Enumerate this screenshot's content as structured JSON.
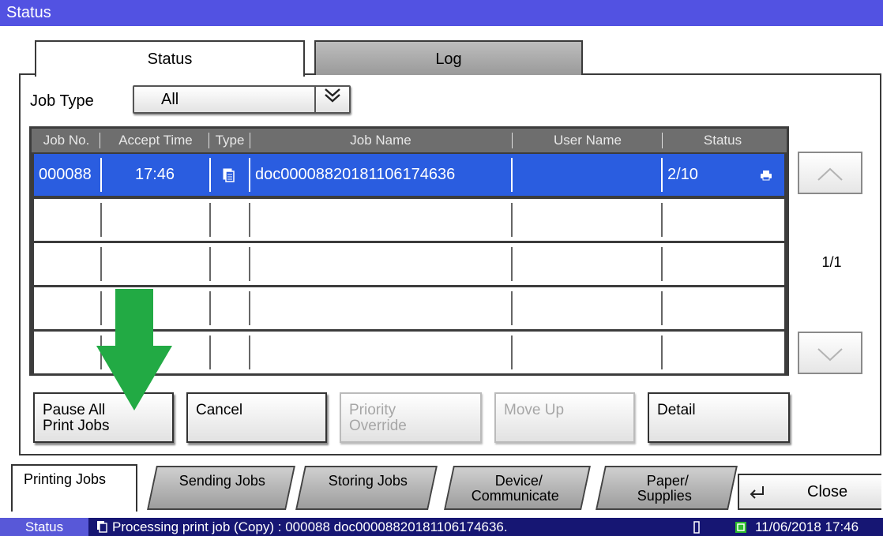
{
  "window": {
    "title": "Status"
  },
  "tabs": [
    {
      "label": "Status",
      "active": true
    },
    {
      "label": "Log",
      "active": false
    }
  ],
  "job_type": {
    "label": "Job Type",
    "value": "All"
  },
  "table": {
    "columns": [
      "Job No.",
      "Accept Time",
      "Type",
      "Job Name",
      "User Name",
      "Status"
    ],
    "rows": [
      {
        "job_no": "000088",
        "accept_time": "17:46",
        "type_icon": "copy-job-icon",
        "job_name": "doc00008820181106174636",
        "user_name": "",
        "status": "2/10",
        "status_icon": "printer-icon",
        "selected": true
      }
    ],
    "empty_rows": 4
  },
  "pager": {
    "page_indicator": "1/1"
  },
  "buttons": {
    "pause_all": {
      "line1": "Pause All",
      "line2": "Print Jobs"
    },
    "cancel": "Cancel",
    "priority_override": {
      "line1": "Priority",
      "line2": "Override"
    },
    "move_up": "Move Up",
    "detail": "Detail"
  },
  "bottom_tabs": {
    "printing_jobs": "Printing Jobs",
    "sending_jobs": "Sending Jobs",
    "storing_jobs": "Storing Jobs",
    "device": {
      "line1": "Device/",
      "line2": "Communicate"
    },
    "paper": {
      "line1": "Paper/",
      "line2": "Supplies"
    },
    "close": "Close"
  },
  "status_bar": {
    "status_label": "Status",
    "message": "Processing print job (Copy) : 000088 doc00008820181106174636.",
    "datetime": "11/06/2018  17:46"
  },
  "colors": {
    "title_bar": "#5252e2",
    "selected_row": "#2a5de0",
    "status_bar": "#161673",
    "arrow": "#22aa44"
  }
}
